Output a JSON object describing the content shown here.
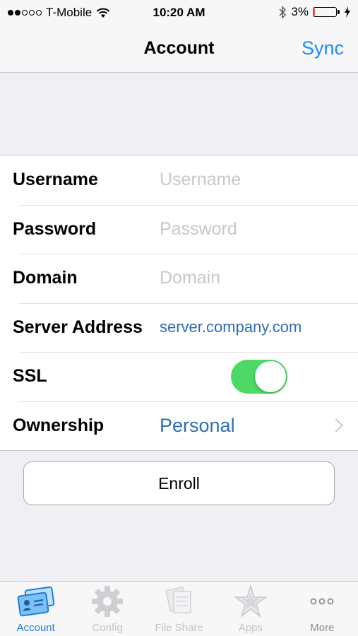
{
  "status_bar": {
    "carrier": "T-Mobile",
    "time": "10:20 AM",
    "battery_percent": "3%",
    "battery_level": 0.03,
    "signal_bars_filled": 2,
    "signal_bars_total": 5
  },
  "nav": {
    "title": "Account",
    "sync_label": "Sync"
  },
  "form": {
    "username": {
      "label": "Username",
      "placeholder": "Username",
      "value": ""
    },
    "password": {
      "label": "Password",
      "placeholder": "Password",
      "value": ""
    },
    "domain": {
      "label": "Domain",
      "placeholder": "Domain",
      "value": ""
    },
    "server_address": {
      "label": "Server Address",
      "value": "server.company.com"
    },
    "ssl": {
      "label": "SSL",
      "enabled": true
    },
    "ownership": {
      "label": "Ownership",
      "value": "Personal"
    }
  },
  "enroll_label": "Enroll",
  "tabs": [
    {
      "label": "Account",
      "icon": "account-card-icon",
      "active": true
    },
    {
      "label": "Config",
      "icon": "gear-icon",
      "active": false
    },
    {
      "label": "File Share",
      "icon": "file-share-icon",
      "active": false
    },
    {
      "label": "Apps",
      "icon": "star-icon",
      "active": false
    },
    {
      "label": "More",
      "icon": "more-dots-icon",
      "active": false
    }
  ],
  "colors": {
    "accent": "#1a8cff",
    "link_value": "#2d6fb5",
    "toggle_on": "#4cd964",
    "battery_low": "#ff3b30",
    "inactive_tab": "#c4c4c8"
  }
}
